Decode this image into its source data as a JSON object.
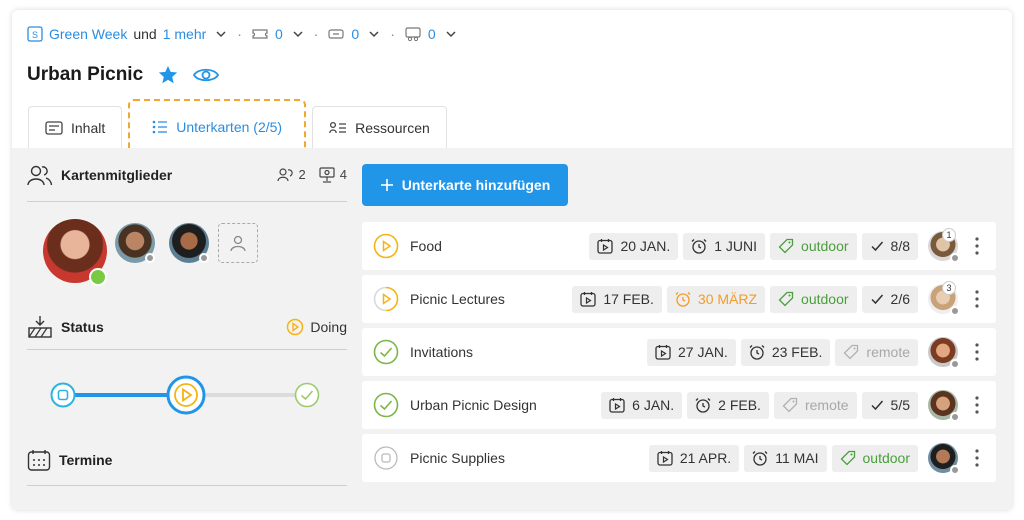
{
  "meta": {
    "project_link": "Green Week",
    "and": "und",
    "more_link": "1 mehr",
    "count_a": "0",
    "count_b": "0",
    "count_c": "0"
  },
  "title": "Urban Picnic",
  "tabs": [
    {
      "label": "Inhalt"
    },
    {
      "label": "Unterkarten (2/5)"
    },
    {
      "label": "Ressourcen"
    }
  ],
  "members": {
    "heading": "Kartenmitglieder",
    "watchers": "2",
    "viewers": "4"
  },
  "status": {
    "heading": "Status",
    "value": "Doing",
    "progress_step": 2
  },
  "dates": {
    "heading": "Termine"
  },
  "add_button": "Unterkarte hinzufügen",
  "subcards": [
    {
      "name": "Food",
      "state": "todo",
      "start": "20 JAN.",
      "due": "1 JUNI",
      "due_style": "normal",
      "tag": "outdoor",
      "tag_style": "green",
      "checklist": "8/8",
      "badge": "1"
    },
    {
      "name": "Picnic Lectures",
      "state": "doing",
      "start": "17 FEB.",
      "due": "30 MÄRZ",
      "due_style": "orange",
      "tag": "outdoor",
      "tag_style": "green",
      "checklist": "2/6",
      "badge": "3"
    },
    {
      "name": "Invitations",
      "state": "done",
      "start": "27 JAN.",
      "due": "23 FEB.",
      "due_style": "normal",
      "tag": "remote",
      "tag_style": "muted",
      "checklist": "",
      "badge": ""
    },
    {
      "name": "Urban Picnic Design",
      "state": "done",
      "start": "6 JAN.",
      "due": "2 FEB.",
      "due_style": "normal",
      "tag": "remote",
      "tag_style": "muted",
      "checklist": "5/5",
      "badge": ""
    },
    {
      "name": "Picnic Supplies",
      "state": "backlog",
      "start": "21 APR.",
      "due": "11 MAI",
      "due_style": "normal",
      "tag": "outdoor",
      "tag_style": "green",
      "checklist": "",
      "badge": ""
    }
  ],
  "colors": {
    "accent": "#2196e8",
    "link": "#2a8de0",
    "done": "#7ab648",
    "todo": "#f5b316",
    "highlight": "#f0a830"
  }
}
